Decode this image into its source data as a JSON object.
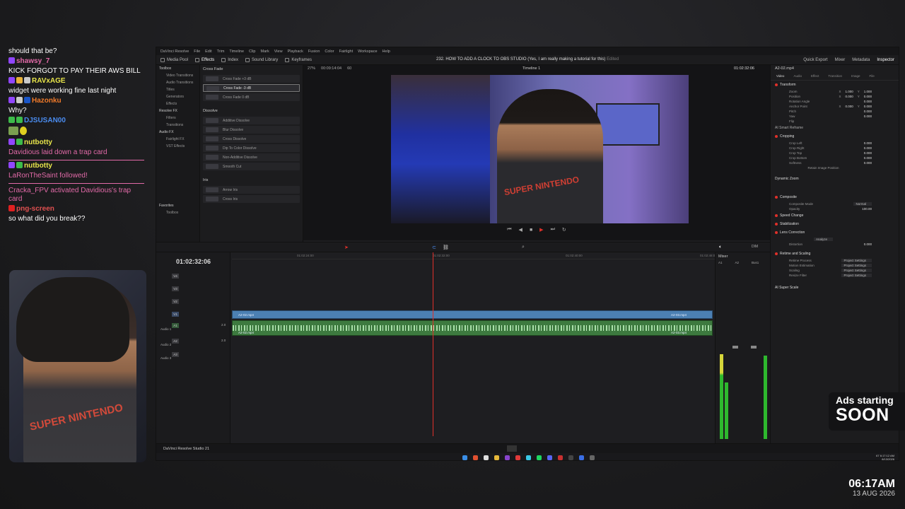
{
  "chat": {
    "messages": [
      {
        "user": "",
        "text": "should that be?",
        "badges": []
      },
      {
        "user": "shawsy_7",
        "text": "",
        "badges": [
          "twitch"
        ]
      },
      {
        "user": "",
        "text": "KICK FORGOT TO PAY THEIR AWS BILL",
        "badges": []
      },
      {
        "user": "RAVxAGE",
        "text": "",
        "badges": [
          "twitch",
          "gold",
          "sub"
        ]
      },
      {
        "user": "",
        "text": "widget were working fine last night",
        "badges": []
      },
      {
        "user": "Hazonku",
        "text": "",
        "badges": [
          "twitch",
          "shield",
          "sub"
        ]
      },
      {
        "user": "",
        "text": "Why?",
        "badges": []
      },
      {
        "user": "DJSUSAN00",
        "text": "",
        "badges": [
          "kick",
          "sub"
        ]
      },
      {
        "user": "",
        "text": "",
        "badges": [
          "emote",
          "emote"
        ]
      },
      {
        "user": "nutbotty",
        "text": "",
        "badges": [
          "twitch",
          "mod"
        ]
      },
      {
        "user": "",
        "text": "Davidious laid down a trap card",
        "badges": []
      }
    ],
    "event1_user": "nutbotty",
    "event1_text": "LaRonTheSaint followed!",
    "event2_text": "Cracka_FPV activated Davidious's trap card",
    "last_user": "png-screen",
    "last_text": "so what did you break??"
  },
  "webcam": {
    "shirt_text": "SUPER NINTENDO"
  },
  "resolve": {
    "menu": [
      "DaVinci Resolve",
      "File",
      "Edit",
      "Trim",
      "Timeline",
      "Clip",
      "Mark",
      "View",
      "Playback",
      "Fusion",
      "Color",
      "Fairlight",
      "Workspace",
      "Help"
    ],
    "toolbar": {
      "media_pool": "Media Pool",
      "effects": "Effects",
      "index": "Index",
      "sound_library": "Sound Library",
      "keyframes": "Keyframes",
      "project_title": "232. HOW TO ADD A CLOCK TO OBS STUDIO (Yes, I am really making a tutorial for this)",
      "edited": "Edited",
      "quick_export": "Quick Export",
      "mixer": "Mixer",
      "metadata": "Metadata",
      "inspector": "Inspector"
    },
    "left_panel": [
      "Toolbox",
      "Video Transitions",
      "Audio Transitions",
      "Titles",
      "Generators",
      "Effects",
      "Resolve FX",
      "Filters",
      "Transitions",
      "Audio FX",
      "Fairlight FX",
      "VST Effects",
      "Favorites",
      "Toolbox"
    ],
    "effects": {
      "cross_fade_title": "Cross Fade",
      "cross_fades": [
        "Cross Fade +3 dB",
        "Cross Fade -3 dB",
        "Cross Fade 0 dB"
      ],
      "dissolve_title": "Dissolve",
      "dissolves": [
        "Additive Dissolve",
        "Blur Dissolve",
        "Cross Dissolve",
        "Dip To Color Dissolve",
        "Non-Additive Dissolve",
        "Smooth Cut"
      ],
      "iris_title": "Iris",
      "iris": [
        "Arrow Iris",
        "Cross Iris"
      ]
    },
    "viewer": {
      "zoom": "27%",
      "duration": "00:09:14:04",
      "fps": "60",
      "timeline_name": "Timeline 1",
      "timecode": "01:02:32:06"
    },
    "inspector": {
      "clip": "A2-02.mp4",
      "tabs": [
        "Video",
        "Audio",
        "Effect",
        "Transition",
        "Image",
        "File"
      ],
      "transform": "Transform",
      "zoom_label": "Zoom",
      "zoom_x": "1.000",
      "zoom_y": "1.000",
      "position_label": "Position",
      "pos_x": "0.000",
      "pos_y": "0.000",
      "rotation_label": "Rotation Angle",
      "rotation": "0.000",
      "anchor_label": "Anchor Point",
      "anchor_x": "0.000",
      "anchor_y": "0.000",
      "pitch_label": "Pitch",
      "pitch": "0.000",
      "yaw_label": "Yaw",
      "yaw": "0.000",
      "flip_label": "Flip",
      "smart_reframe": "AI Smart Reframe",
      "cropping": "Cropping",
      "crop_left": "Crop Left",
      "crop_right": "Crop Right",
      "crop_top": "Crop Top",
      "crop_bottom": "Crop Bottom",
      "softness": "Softness",
      "crop_val": "0.000",
      "retain": "Retain Image Position",
      "dynamic_zoom": "Dynamic Zoom",
      "composite": "Composite",
      "composite_mode_label": "Composite Mode",
      "composite_mode": "Normal",
      "opacity_label": "Opacity",
      "opacity": "100.00",
      "speed_change": "Speed Change",
      "stabilization": "Stabilization",
      "lens_correction": "Lens Correction",
      "analyze": "Analyze",
      "distortion_label": "Distortion",
      "distortion": "0.000",
      "retime": "Retime and Scaling",
      "retime_process": "Retime Process",
      "motion_estimation": "Motion Estimation",
      "scaling": "Scaling",
      "resize_filter": "Resize Filter",
      "project_settings": "Project Settings",
      "ai_super_scale": "AI Super Scale"
    },
    "timeline": {
      "timecode": "01:02:32:06",
      "ruler": [
        "01:02:24:00",
        "01:02:32:00",
        "01:02:40:00",
        "01:02:48:00"
      ],
      "tracks": [
        "V4",
        "V3",
        "V2",
        "V1",
        "A1",
        "A2",
        "A3"
      ],
      "audio_names": [
        "Audio 1",
        "Audio 2",
        "Audio 3"
      ],
      "clip_name": "A2-02.mp4",
      "clip_name2": "A2-03.mp4",
      "volume": "2.0"
    },
    "mixer": {
      "title": "Mixer",
      "channels": [
        "A1",
        "A2",
        "Bus1"
      ],
      "dim": "DIM"
    },
    "status": {
      "app": "DaVinci Resolve Studio 21"
    },
    "tray": {
      "temp": "67",
      "time": "6:17:12 AM",
      "date": "8/13/2026"
    }
  },
  "ads": {
    "line1": "Ads starting",
    "line2": "SOON"
  },
  "clock": {
    "time": "06:17AM",
    "date": "13 AUG 2026"
  }
}
